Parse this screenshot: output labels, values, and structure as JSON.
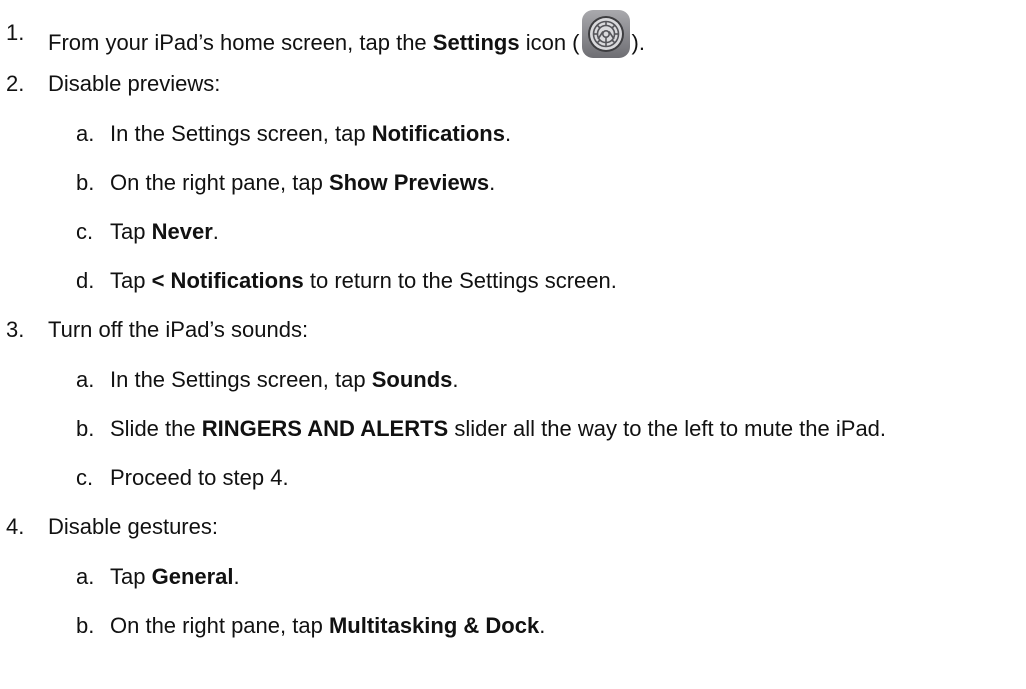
{
  "steps": [
    {
      "number": "1.",
      "before": "From your iPad’s home screen, tap the ",
      "bold": "Settings",
      "middle": " icon (",
      "icon": "settings-gear-icon",
      "after": ")."
    },
    {
      "number": "2.",
      "text": "Disable previews:",
      "substeps": [
        {
          "letter": "a.",
          "before": "In the Settings screen, tap ",
          "bold": "Notifications",
          "after": "."
        },
        {
          "letter": "b.",
          "before": "On the right pane, tap ",
          "bold": "Show Previews",
          "after": "."
        },
        {
          "letter": "c.",
          "before": "Tap ",
          "bold": "Never",
          "after": "."
        },
        {
          "letter": "d.",
          "before": "Tap ",
          "bold": "< Notifications",
          "after": " to return to the Settings screen."
        }
      ]
    },
    {
      "number": "3.",
      "text": "Turn off the iPad’s sounds:",
      "substeps": [
        {
          "letter": "a.",
          "before": "In the Settings screen, tap ",
          "bold": "Sounds",
          "after": "."
        },
        {
          "letter": "b.",
          "before": "Slide the ",
          "bold": "RINGERS AND ALERTS",
          "after": " slider all the way to the left to mute the iPad."
        },
        {
          "letter": "c.",
          "text": "Proceed to step 4."
        }
      ]
    },
    {
      "number": "4.",
      "text": "Disable gestures:",
      "substeps": [
        {
          "letter": "a.",
          "before": "Tap ",
          "bold": "General",
          "after": "."
        },
        {
          "letter": "b.",
          "before": "On the right pane, tap ",
          "bold": "Multitasking & Dock",
          "after": "."
        }
      ]
    }
  ]
}
